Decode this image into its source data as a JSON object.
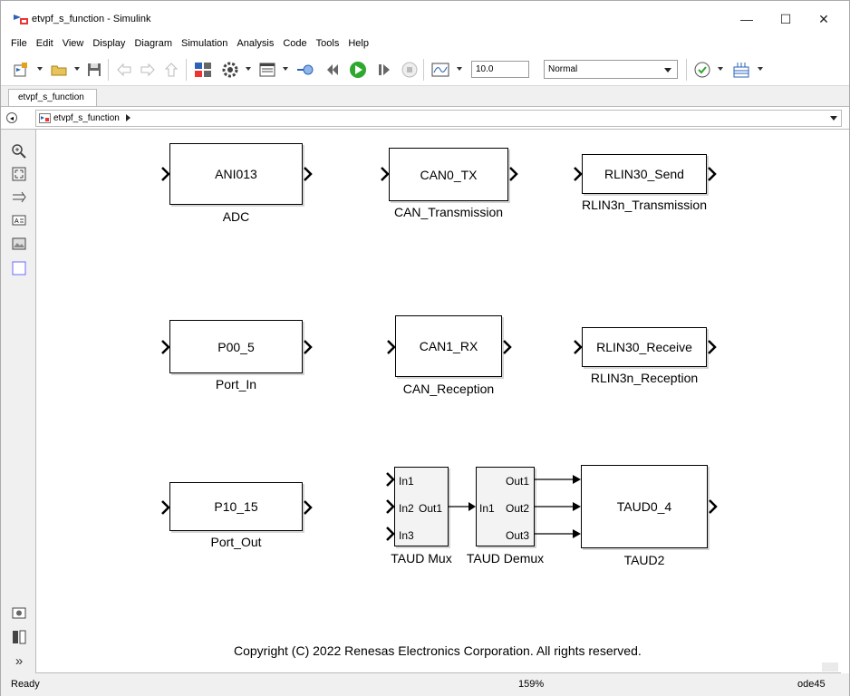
{
  "window": {
    "title": "etvpf_s_function - Simulink",
    "controls": {
      "minimize": "—",
      "maximize": "☐",
      "close": "✕"
    }
  },
  "menu": [
    "File",
    "Edit",
    "View",
    "Display",
    "Diagram",
    "Simulation",
    "Analysis",
    "Code",
    "Tools",
    "Help"
  ],
  "toolbar": {
    "stop_time": "10.0",
    "sim_mode": "Normal",
    "icons": [
      "new-model-icon",
      "open-folder-icon",
      "save-icon",
      "back-icon",
      "forward-icon",
      "up-icon",
      "library-browser-icon",
      "model-settings-icon",
      "model-explorer-icon",
      "signal-log-icon",
      "step-back-icon",
      "run-icon",
      "step-forward-icon",
      "stop-icon",
      "scope-icon",
      "model-advisor-icon",
      "build-icon"
    ]
  },
  "tab": {
    "label": "etvpf_s_function"
  },
  "explorer": {
    "breadcrumb": "etvpf_s_function"
  },
  "palette": {
    "icons": [
      "zoom-icon",
      "fit-to-view-icon",
      "signal-arrow-icon",
      "annotation-icon",
      "image-icon",
      "area-icon",
      "screenshot-icon",
      "model-browser-icon",
      "expand-icon"
    ],
    "expand_glyph": "»"
  },
  "blocks": [
    {
      "id": "adc",
      "content": "ANI013",
      "name": "ADC"
    },
    {
      "id": "can-tx",
      "content": "CAN0_TX",
      "name": "CAN_Transmission"
    },
    {
      "id": "rlin-send",
      "content": "RLIN30_Send",
      "name": "RLIN3n_Transmission"
    },
    {
      "id": "port-in",
      "content": "P00_5",
      "name": "Port_In"
    },
    {
      "id": "can-rx",
      "content": "CAN1_RX",
      "name": "CAN_Reception"
    },
    {
      "id": "rlin-recv",
      "content": "RLIN30_Receive",
      "name": "RLIN3n_Reception"
    },
    {
      "id": "port-out",
      "content": "P10_15",
      "name": "Port_Out"
    },
    {
      "id": "taud2",
      "content": "TAUD0_4",
      "name": "TAUD2"
    }
  ],
  "mux": {
    "name": "TAUD Mux",
    "inputs": [
      "In1",
      "In2",
      "In3"
    ],
    "output": "Out1"
  },
  "demux": {
    "name": "TAUD Demux",
    "input": "In1",
    "outputs": [
      "Out1",
      "Out2",
      "Out3"
    ]
  },
  "annotation": "Copyright (C) 2022 Renesas Electronics Corporation. All rights reserved.",
  "status": {
    "state": "Ready",
    "zoom": "159%",
    "solver": "ode45"
  }
}
